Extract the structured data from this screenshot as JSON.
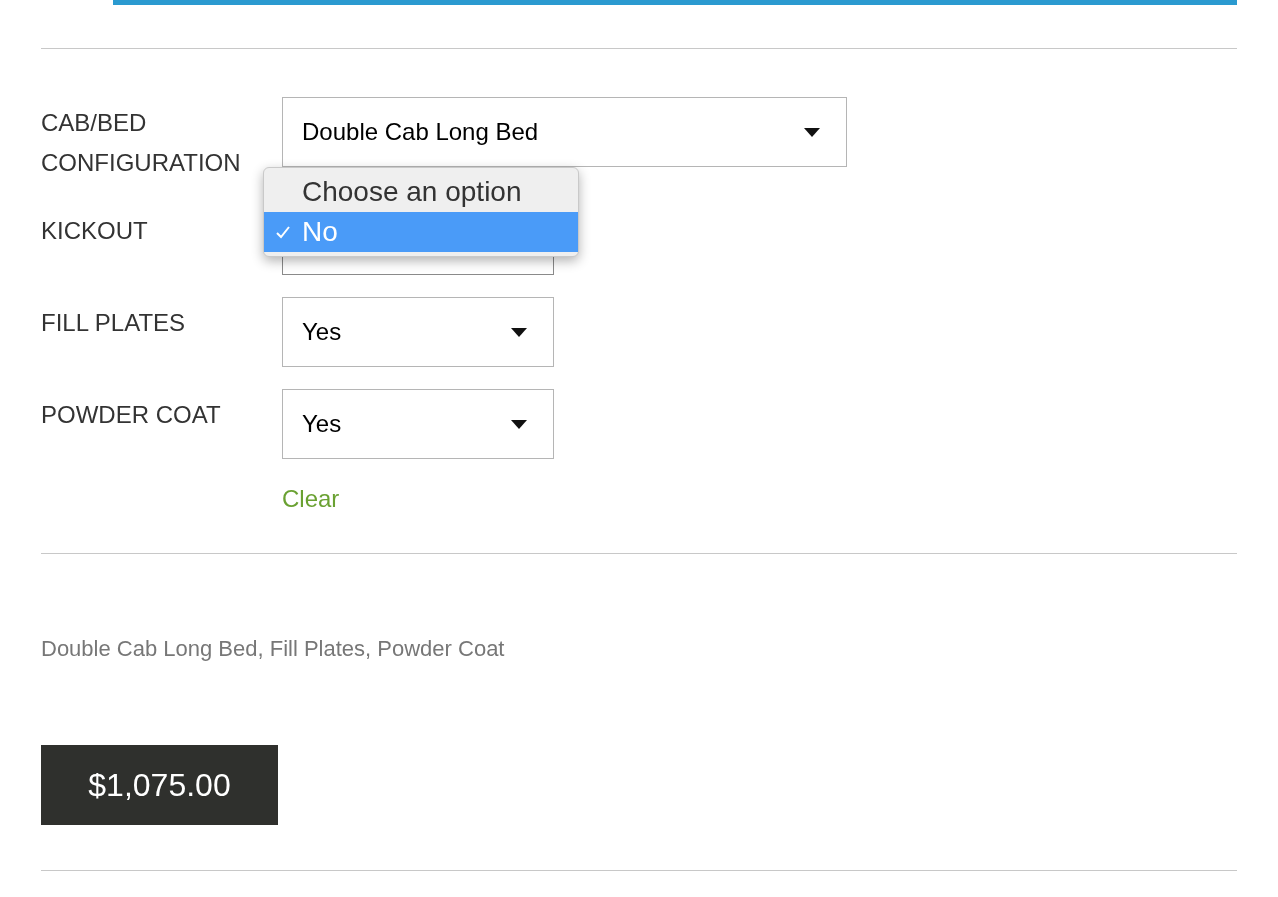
{
  "fields": [
    {
      "label": "CAB/BED CONFIGURATION",
      "value": "Double Cab Long Bed",
      "expanded": false
    },
    {
      "label": "KICKOUT",
      "expanded": true,
      "options": [
        {
          "label": "Choose an option",
          "selected": false
        },
        {
          "label": "No",
          "selected": true
        }
      ]
    },
    {
      "label": "FILL PLATES",
      "value": "Yes",
      "expanded": false
    },
    {
      "label": "POWDER COAT",
      "value": "Yes",
      "expanded": false
    }
  ],
  "clear_link": "Clear",
  "summary": "Double Cab Long Bed, Fill Plates, Powder Coat",
  "price": "$1,075.00"
}
